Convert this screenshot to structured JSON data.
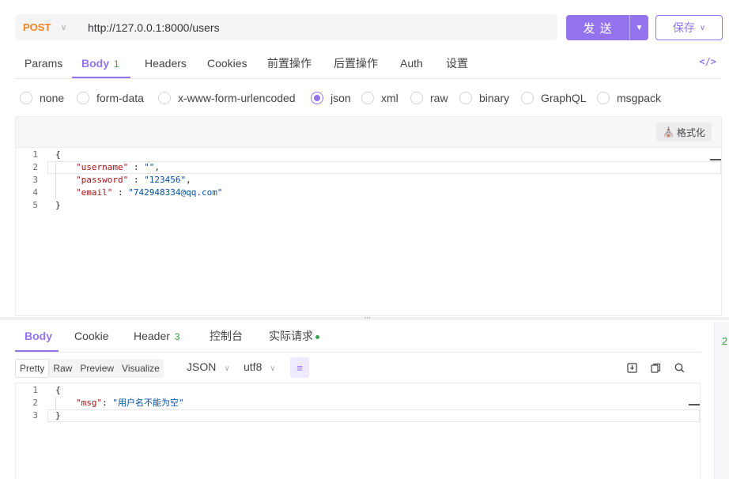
{
  "request": {
    "method": "POST",
    "url": "http://127.0.0.1:8000/users",
    "send_label": "发 送",
    "save_label": "保存"
  },
  "request_tabs": [
    {
      "label": "Params"
    },
    {
      "label": "Body",
      "badge": "1",
      "active": true
    },
    {
      "label": "Headers"
    },
    {
      "label": "Cookies"
    },
    {
      "label": "前置操作"
    },
    {
      "label": "后置操作"
    },
    {
      "label": "Auth"
    },
    {
      "label": "设置"
    }
  ],
  "body_types": [
    {
      "label": "none"
    },
    {
      "label": "form-data"
    },
    {
      "label": "x-www-form-urlencoded"
    },
    {
      "label": "json",
      "checked": true
    },
    {
      "label": "xml"
    },
    {
      "label": "raw"
    },
    {
      "label": "binary"
    },
    {
      "label": "GraphQL"
    },
    {
      "label": "msgpack"
    }
  ],
  "request_editor": {
    "format_label": "格式化",
    "lines": [
      {
        "n": "1",
        "text": "{"
      },
      {
        "n": "2",
        "key": "\"username\"",
        "sep": " : ",
        "value": "\"\"",
        "tail": ","
      },
      {
        "n": "3",
        "key": "\"password\"",
        "sep": " : ",
        "value": "\"123456\"",
        "tail": ","
      },
      {
        "n": "4",
        "key": "\"email\"",
        "sep": " : ",
        "value": "\"742948334@qq.com\"",
        "tail": ""
      },
      {
        "n": "5",
        "text": "}"
      }
    ]
  },
  "response_tabs": [
    {
      "label": "Body",
      "active": true
    },
    {
      "label": "Cookie"
    },
    {
      "label": "Header",
      "badge": "3"
    },
    {
      "label": "控制台"
    },
    {
      "label": "实际请求",
      "dot": true
    }
  ],
  "response_toolbar": {
    "views": [
      "Pretty",
      "Raw",
      "Preview",
      "Visualize"
    ],
    "active_view": "Pretty",
    "format": "JSON",
    "encoding": "utf8"
  },
  "response_editor": {
    "lines": [
      {
        "n": "1",
        "text": "{"
      },
      {
        "n": "2",
        "key": "\"msg\"",
        "sep": ": ",
        "value": "\"用户名不能为空\"",
        "tail": ""
      },
      {
        "n": "3",
        "text": "}"
      }
    ]
  },
  "side_panel": {
    "number": "2"
  },
  "colors": {
    "accent": "#9373ee",
    "method": "#f5841f",
    "badge": "#37a14b"
  }
}
